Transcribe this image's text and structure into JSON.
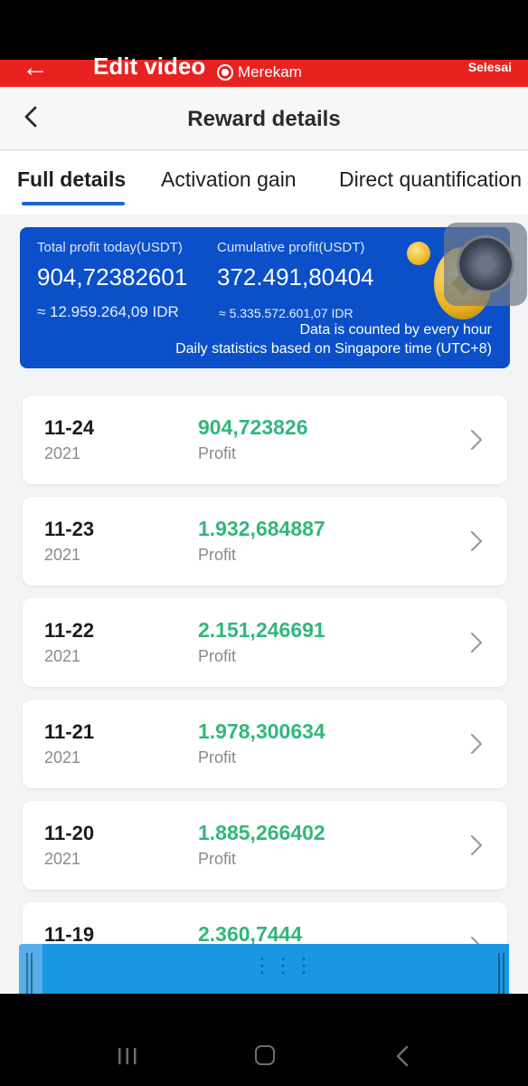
{
  "editor": {
    "title": "Edit video",
    "record_label": "Merekam",
    "done_label": "Selesai",
    "accent_color": "#e8231f"
  },
  "header": {
    "title": "Reward details"
  },
  "tabs": [
    {
      "label": "Full details",
      "active": true
    },
    {
      "label": "Activation gain",
      "active": false
    },
    {
      "label": "Direct quantification",
      "active": false
    }
  ],
  "summary": {
    "today_label": "Total profit today(USDT)",
    "today_value": "904,72382601",
    "today_idr": "≈ 12.959.264,09 IDR",
    "cumulative_label": "Cumulative profit(USDT)",
    "cumulative_value": "372.491,80404",
    "cumulative_idr": "≈ 5.335.572.601,07 IDR",
    "note_line1": "Data is counted by every hour",
    "note_line2": "Daily statistics based on Singapore time (UTC+8)",
    "card_color": "#0b50c8"
  },
  "records": [
    {
      "date": "11-24",
      "year": "2021",
      "amount": "904,723826",
      "label": "Profit"
    },
    {
      "date": "11-23",
      "year": "2021",
      "amount": "1.932,684887",
      "label": "Profit"
    },
    {
      "date": "11-22",
      "year": "2021",
      "amount": "2.151,246691",
      "label": "Profit"
    },
    {
      "date": "11-21",
      "year": "2021",
      "amount": "1.978,300634",
      "label": "Profit"
    },
    {
      "date": "11-20",
      "year": "2021",
      "amount": "1.885,266402",
      "label": "Profit"
    },
    {
      "date": "11-19",
      "year": "",
      "amount": "2.360,7444",
      "label": ""
    }
  ],
  "colors": {
    "profit_green": "#32b77a",
    "tab_underline": "#1d64d8",
    "scrubber_blue": "#1996e4"
  },
  "icons": {
    "back": "back-arrow-icon",
    "header_back": "chevron-left-icon",
    "row_chevron": "chevron-right-icon",
    "coin": "ethereum-coin-icon",
    "nav_recent": "recent-apps-icon",
    "nav_home": "home-icon",
    "nav_back": "nav-back-icon"
  }
}
